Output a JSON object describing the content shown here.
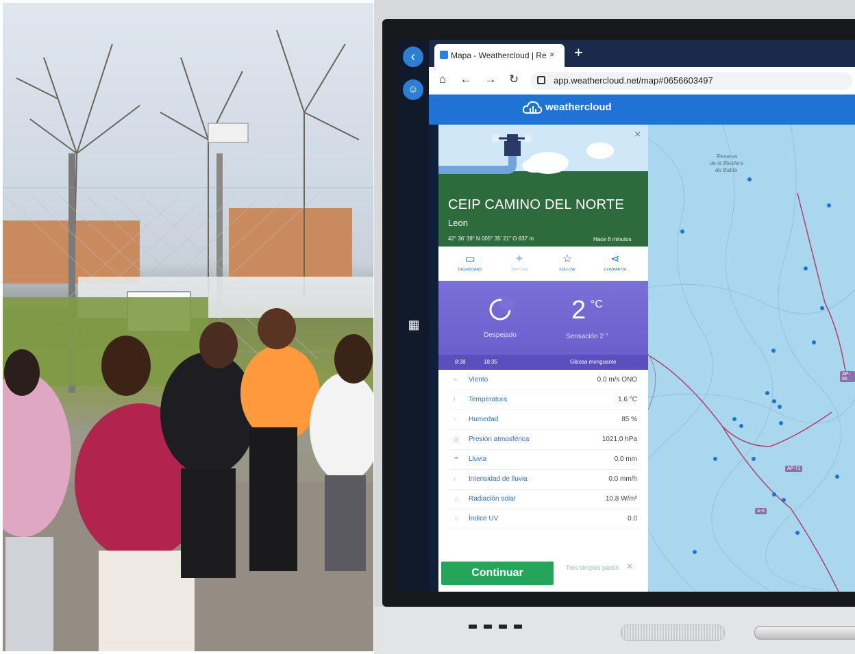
{
  "browser": {
    "tab_title": "Mapa - Weathercloud | Red m",
    "tab_close": "×",
    "new_tab": "+",
    "url": "app.weathercloud.net/map#0656603497"
  },
  "brand": {
    "logo_text": "weathercloud"
  },
  "station": {
    "name": "CEIP CAMINO DEL NORTE",
    "city": "Leon",
    "coords": "42° 36' 39\" N  005° 35' 21\" O  837 m",
    "updated": "Hace 8 minutos",
    "close": "×"
  },
  "actions": [
    {
      "label": "DASHBOARD",
      "icon": "monitor-icon"
    },
    {
      "label": "TWITTER",
      "icon": "twitter-icon"
    },
    {
      "label": "FOLLOW",
      "icon": "star-icon"
    },
    {
      "label": "COMPARTIR",
      "icon": "share-icon"
    }
  ],
  "current": {
    "condition": "Despejado",
    "temperature": "2",
    "unit": "°C",
    "feels_like": "Sensación 2 °",
    "sunrise": "8:38",
    "sunset": "18:35",
    "moon": "Gibosa menguante"
  },
  "readings": [
    {
      "label": "Viento",
      "value": "0.0 m/s ONO"
    },
    {
      "label": "Temperatura",
      "value": "1.6 °C"
    },
    {
      "label": "Humedad",
      "value": "85 %"
    },
    {
      "label": "Presión atmosférica",
      "value": "1021.0 hPa"
    },
    {
      "label": "Lluvia",
      "value": "0.0 mm"
    },
    {
      "label": "Intensidad de lluvia",
      "value": "0.0 mm/h"
    },
    {
      "label": "Radiación solar",
      "value": "10.8 W/m²"
    },
    {
      "label": "Índice UV",
      "value": "0.0"
    }
  ],
  "cta": {
    "button": "Continuar",
    "tips": "Tres simples pasos"
  },
  "map": {
    "labels": [
      "Reserva",
      "de la Biosfera",
      "de Babia"
    ],
    "roads": [
      "AP-66",
      "AP-71",
      "A-6"
    ]
  },
  "colors": {
    "brand_blue": "#1e73d4",
    "station_green": "#2d6b3c",
    "weather_purple": "#7b6fd8",
    "continue_green": "#25a559"
  }
}
